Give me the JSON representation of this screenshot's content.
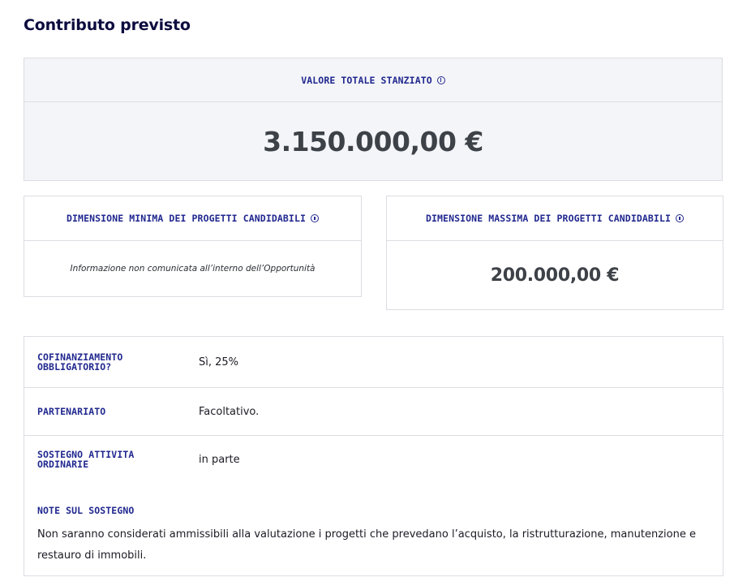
{
  "header": {
    "title": "Contributo previsto"
  },
  "total": {
    "label": "VALORE TOTALE STANZIATO",
    "value": "3.150.000,00 €"
  },
  "min_size": {
    "label": "DIMENSIONE MINIMA DEI PROGETTI CANDIDABILI",
    "note": "Informazione non comunicata all’interno dell’Opportunità"
  },
  "max_size": {
    "label": "DIMENSIONE MASSIMA DEI PROGETTI CANDIDABILI",
    "value": "200.000,00 €"
  },
  "details": {
    "rows": [
      {
        "label_line1": "COFINANZIAMENTO",
        "label_line2": "OBBLIGATORIO?",
        "value": "Sì, 25%"
      },
      {
        "label_line1": "PARTENARIATO",
        "label_line2": "",
        "value": "Facoltativo."
      },
      {
        "label_line1": "SOSTEGNO ATTIVITA",
        "label_line2": "ORDINARIE",
        "value": "in parte"
      }
    ],
    "notes_label": "NOTE SUL SOSTEGNO",
    "notes_text": "Non saranno considerati ammissibili alla valutazione i progetti che prevedano l’acquisto, la ristrutturazione, manutenzione e restauro di immobili."
  },
  "icons": {
    "info": "info-icon"
  },
  "colors": {
    "title": "#0d0c3f",
    "label": "#21288f",
    "value": "#3d4248",
    "border": "#dcdde3",
    "total_bg": "#f4f5f8"
  }
}
